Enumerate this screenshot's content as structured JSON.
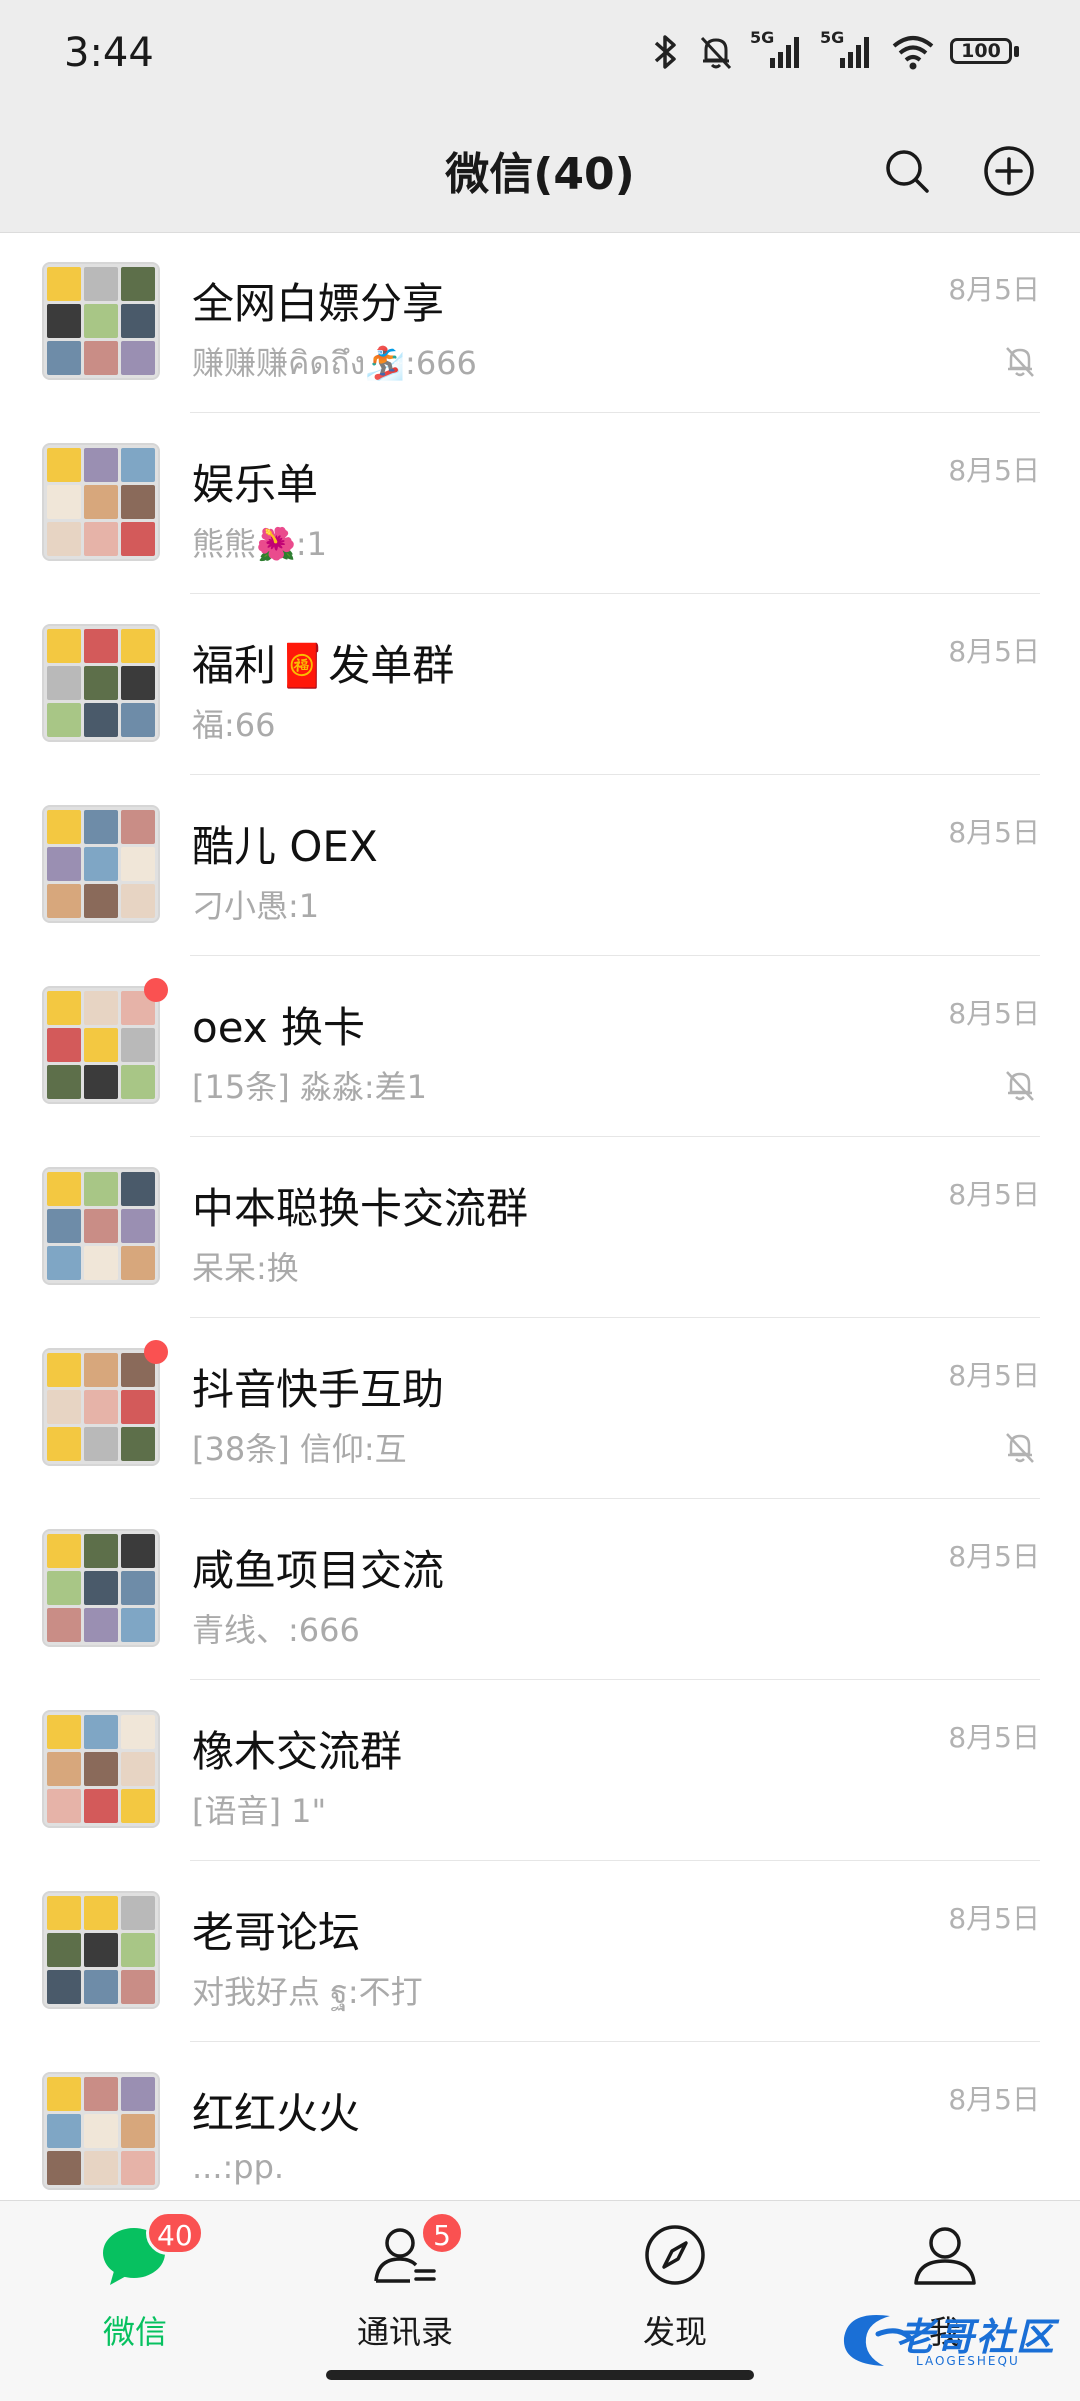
{
  "status_bar": {
    "time": "3:44",
    "network_1": "5G",
    "network_2": "5G",
    "battery": "100"
  },
  "header": {
    "title": "微信(40)",
    "search_icon": "search-icon",
    "add_icon": "plus-circle-icon"
  },
  "chats": [
    {
      "name": "全网白嫖分享",
      "preview": "赚赚赚คิดถึง🏂:666",
      "time": "8月5日",
      "muted": true,
      "unread_dot": false
    },
    {
      "name": "娱乐单",
      "preview": "熊熊🌺:1",
      "time": "8月5日",
      "muted": false,
      "unread_dot": false
    },
    {
      "name": "福利🧧发单群",
      "preview": "福:66",
      "time": "8月5日",
      "muted": false,
      "unread_dot": false
    },
    {
      "name": "酷儿 OEX",
      "preview": "刁小愚:1",
      "time": "8月5日",
      "muted": false,
      "unread_dot": false
    },
    {
      "name": "oex 换卡",
      "preview": "[15条] 淼淼:差1",
      "time": "8月5日",
      "muted": true,
      "unread_dot": true
    },
    {
      "name": "中本聪换卡交流群",
      "preview": "呆呆:换",
      "time": "8月5日",
      "muted": false,
      "unread_dot": false
    },
    {
      "name": "抖音快手互助",
      "preview": "[38条] 信仰:互",
      "time": "8月5日",
      "muted": true,
      "unread_dot": true
    },
    {
      "name": "咸鱼项目交流",
      "preview": "青线、:666",
      "time": "8月5日",
      "muted": false,
      "unread_dot": false
    },
    {
      "name": "橡木交流群",
      "preview": "[语音] 1\"",
      "time": "8月5日",
      "muted": false,
      "unread_dot": false
    },
    {
      "name": "老哥论坛",
      "preview": " 对我好点  ฐ:不打",
      "time": "8月5日",
      "muted": false,
      "unread_dot": false
    },
    {
      "name": "红红火火",
      "preview": "...:pp.",
      "time": "8月5日",
      "muted": false,
      "unread_dot": false
    }
  ],
  "tabs": [
    {
      "label": "微信",
      "badge": "40",
      "icon": "chat-bubble-icon",
      "active": true
    },
    {
      "label": "通讯录",
      "badge": "5",
      "icon": "contacts-icon",
      "active": false
    },
    {
      "label": "发现",
      "badge": "",
      "icon": "compass-icon",
      "active": false
    },
    {
      "label": "我",
      "badge": "",
      "icon": "person-icon",
      "active": false
    }
  ],
  "watermark": {
    "text": "老哥社区",
    "subtext": "LAOGESHEQU"
  },
  "colors": {
    "accent": "#07c160",
    "badge": "#fa5151",
    "header_bg": "#ededed",
    "tabbar_bg": "#f7f7f7"
  }
}
